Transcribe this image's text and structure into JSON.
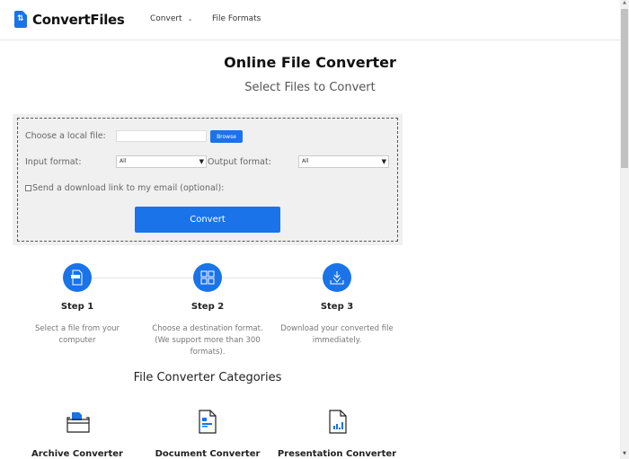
{
  "header": {
    "logo_text": "ConvertFiles",
    "nav": [
      {
        "label": "Convert",
        "has_dropdown": true
      },
      {
        "label": "File Formats",
        "has_dropdown": false
      }
    ]
  },
  "hero": {
    "title": "Online File Converter",
    "subtitle": "Select Files to Convert"
  },
  "form": {
    "file_label": "Choose a local file:",
    "file_value": "",
    "browse_label": "Browse",
    "input_format_label": "Input format:",
    "input_format_value": "All",
    "output_format_label": "Output format:",
    "output_format_value": "All",
    "email_checkbox_label": "Send a download link to my email (optional):",
    "email_checked": false,
    "convert_label": "Convert"
  },
  "steps": [
    {
      "title": "Step 1",
      "desc": "Select a file from your computer",
      "icon": "file-upload-icon"
    },
    {
      "title": "Step 2",
      "desc": "Choose a destination format. (We support more than 300 formats).",
      "icon": "grid-icon"
    },
    {
      "title": "Step 3",
      "desc": "Download your converted file immediately.",
      "icon": "download-icon"
    }
  ],
  "categories": {
    "title": "File Converter Categories",
    "items": [
      {
        "label": "Archive Converter",
        "icon": "archive-icon"
      },
      {
        "label": "Document Converter",
        "icon": "document-icon"
      },
      {
        "label": "Presentation Converter",
        "icon": "presentation-icon"
      }
    ]
  },
  "colors": {
    "accent": "#1a73e8",
    "form_bg": "#f0f0f0"
  }
}
